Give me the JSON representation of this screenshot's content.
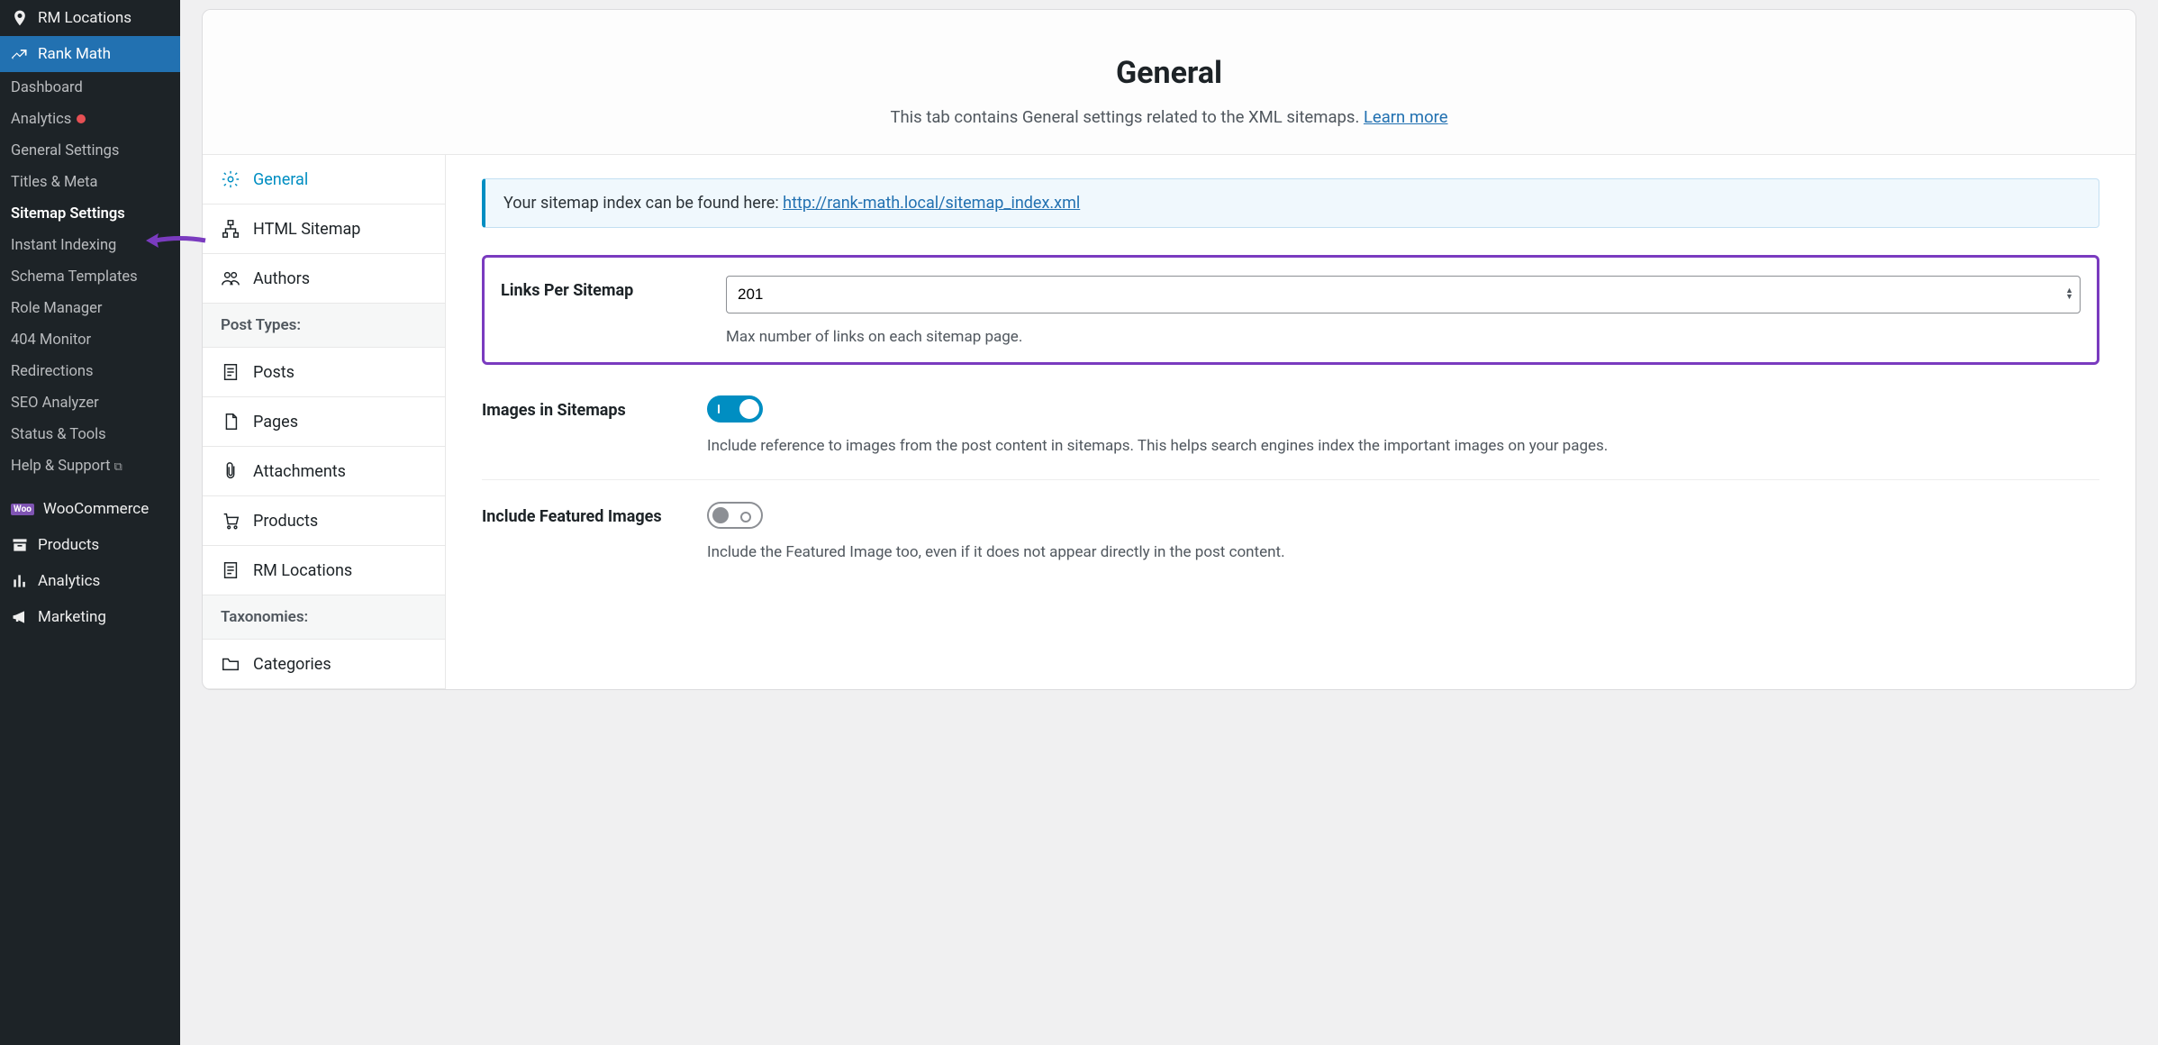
{
  "sidebar": {
    "top_item": "RM Locations",
    "active_item": "Rank Math",
    "submenu": [
      {
        "label": "Dashboard",
        "current": false,
        "badge": false
      },
      {
        "label": "Analytics",
        "current": false,
        "badge": true
      },
      {
        "label": "General Settings",
        "current": false,
        "badge": false
      },
      {
        "label": "Titles & Meta",
        "current": false,
        "badge": false
      },
      {
        "label": "Sitemap Settings",
        "current": true,
        "badge": false
      },
      {
        "label": "Instant Indexing",
        "current": false,
        "badge": false
      },
      {
        "label": "Schema Templates",
        "current": false,
        "badge": false
      },
      {
        "label": "Role Manager",
        "current": false,
        "badge": false
      },
      {
        "label": "404 Monitor",
        "current": false,
        "badge": false
      },
      {
        "label": "Redirections",
        "current": false,
        "badge": false
      },
      {
        "label": "SEO Analyzer",
        "current": false,
        "badge": false
      },
      {
        "label": "Status & Tools",
        "current": false,
        "badge": false
      },
      {
        "label": "Help & Support",
        "current": false,
        "badge": false,
        "external": true
      }
    ],
    "bottom": [
      {
        "label": "WooCommerce",
        "icon": "woo"
      },
      {
        "label": "Products",
        "icon": "archive"
      },
      {
        "label": "Analytics",
        "icon": "bars"
      },
      {
        "label": "Marketing",
        "icon": "megaphone"
      }
    ]
  },
  "header": {
    "title": "General",
    "subtitle_pre": "This tab contains General settings related to the XML sitemaps. ",
    "subtitle_link": "Learn more"
  },
  "tabs": {
    "items": [
      {
        "label": "General",
        "icon": "gear",
        "active": true
      },
      {
        "label": "HTML Sitemap",
        "icon": "sitemap",
        "active": false
      },
      {
        "label": "Authors",
        "icon": "users",
        "active": false
      }
    ],
    "group1": "Post Types:",
    "post_types": [
      {
        "label": "Posts",
        "icon": "post"
      },
      {
        "label": "Pages",
        "icon": "page"
      },
      {
        "label": "Attachments",
        "icon": "attach"
      },
      {
        "label": "Products",
        "icon": "cart"
      },
      {
        "label": "RM Locations",
        "icon": "post"
      }
    ],
    "group2": "Taxonomies:",
    "taxonomies": [
      {
        "label": "Categories",
        "icon": "folder"
      }
    ]
  },
  "notice": {
    "text": "Your sitemap index can be found here: ",
    "url": "http://rank-math.local/sitemap_index.xml"
  },
  "settings": {
    "links_per_sitemap": {
      "label": "Links Per Sitemap",
      "value": "201",
      "help": "Max number of links on each sitemap page."
    },
    "images_in_sitemaps": {
      "label": "Images in Sitemaps",
      "help": "Include reference to images from the post content in sitemaps. This helps search engines index the important images on your pages."
    },
    "include_featured": {
      "label": "Include Featured Images",
      "help": "Include the Featured Image too, even if it does not appear directly in the post content."
    }
  }
}
